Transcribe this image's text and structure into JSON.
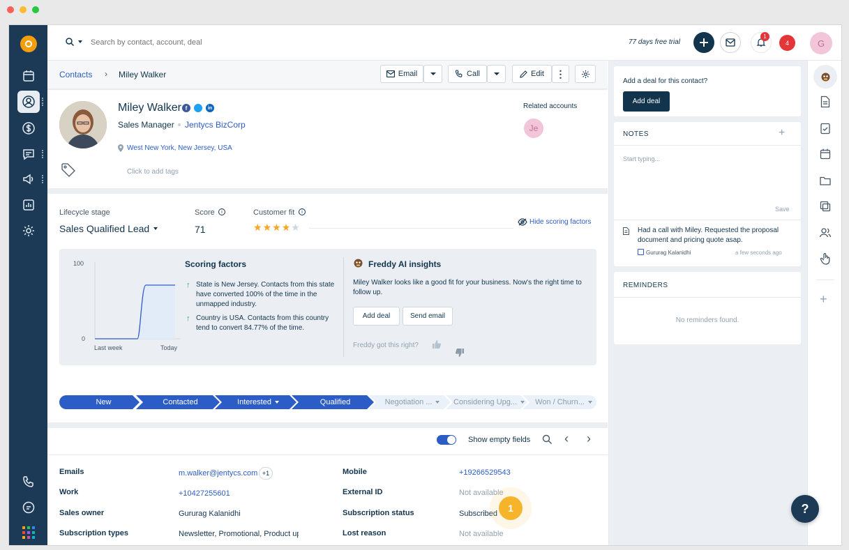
{
  "topbar": {
    "search_placeholder": "Search by contact, account, deal",
    "trial": "77 days free trial",
    "notif_count": "1",
    "alert_count": "4",
    "avatar": "G"
  },
  "breadcrumb": {
    "parent": "Contacts",
    "current": "Miley Walker"
  },
  "actions": {
    "email": "Email",
    "call": "Call",
    "edit": "Edit"
  },
  "contact": {
    "name": "Miley Walker",
    "title": "Sales Manager",
    "company": "Jentycs BizCorp",
    "location": "West New York, New Jersey, USA",
    "tags_placeholder": "Click to add tags",
    "related_label": "Related accounts",
    "related_initials": "Je"
  },
  "scoring": {
    "lifecycle_label": "Lifecycle stage",
    "lifecycle_value": "Sales Qualified Lead",
    "score_label": "Score",
    "score_value": "71",
    "fit_label": "Customer fit",
    "fit_stars": 4,
    "fit_max": 5,
    "hide_link": "Hide scoring factors",
    "chart_ymax": "100",
    "chart_ymin": "0",
    "chart_x_start": "Last week",
    "chart_x_end": "Today",
    "factors_title": "Scoring factors",
    "factor1": "State is New Jersey. Contacts from this state have converted 100% of the time in the unmapped industry.",
    "factor2": "Country is USA. Contacts from this country tend to convert 84.77% of the time.",
    "ai_title": "Freddy AI insights",
    "ai_text": "Miley Walker looks like a good fit for your business. Now's the right time to follow up.",
    "add_deal": "Add deal",
    "send_email": "Send email",
    "feedback": "Freddy got this right?"
  },
  "stages": [
    "New",
    "Contacted",
    "Interested",
    "Qualified",
    "Negotiation ...",
    "Considering Upg...",
    "Won / Churn..."
  ],
  "details": {
    "show_empty": "Show empty fields",
    "emails_label": "Emails",
    "emails_value": "m.walker@jentycs.com",
    "emails_more": "+1",
    "work_label": "Work",
    "work_value": "+10427255601",
    "owner_label": "Sales owner",
    "owner_value": "Gururag Kalanidhi",
    "subtypes_label": "Subscription types",
    "subtypes_value": "Newsletter, Promotional, Product up",
    "mobile_label": "Mobile",
    "mobile_value": "+19266529543",
    "extid_label": "External ID",
    "extid_value": "Not available",
    "substatus_label": "Subscription status",
    "substatus_value": "Subscribed",
    "lost_label": "Lost reason",
    "lost_value": "Not available",
    "hotspot": "1"
  },
  "deal_card": {
    "prompt": "Add a deal for this contact?",
    "button": "Add deal"
  },
  "notes": {
    "title": "NOTES",
    "placeholder": "Start typing...",
    "save": "Save",
    "entry": "Had a call with Miley. Requested the proposal document and pricing quote asap.",
    "author": "Gururag Kalanidhi",
    "time": "a few seconds ago"
  },
  "reminders": {
    "title": "REMINDERS",
    "empty": "No reminders found."
  },
  "help": "?"
}
